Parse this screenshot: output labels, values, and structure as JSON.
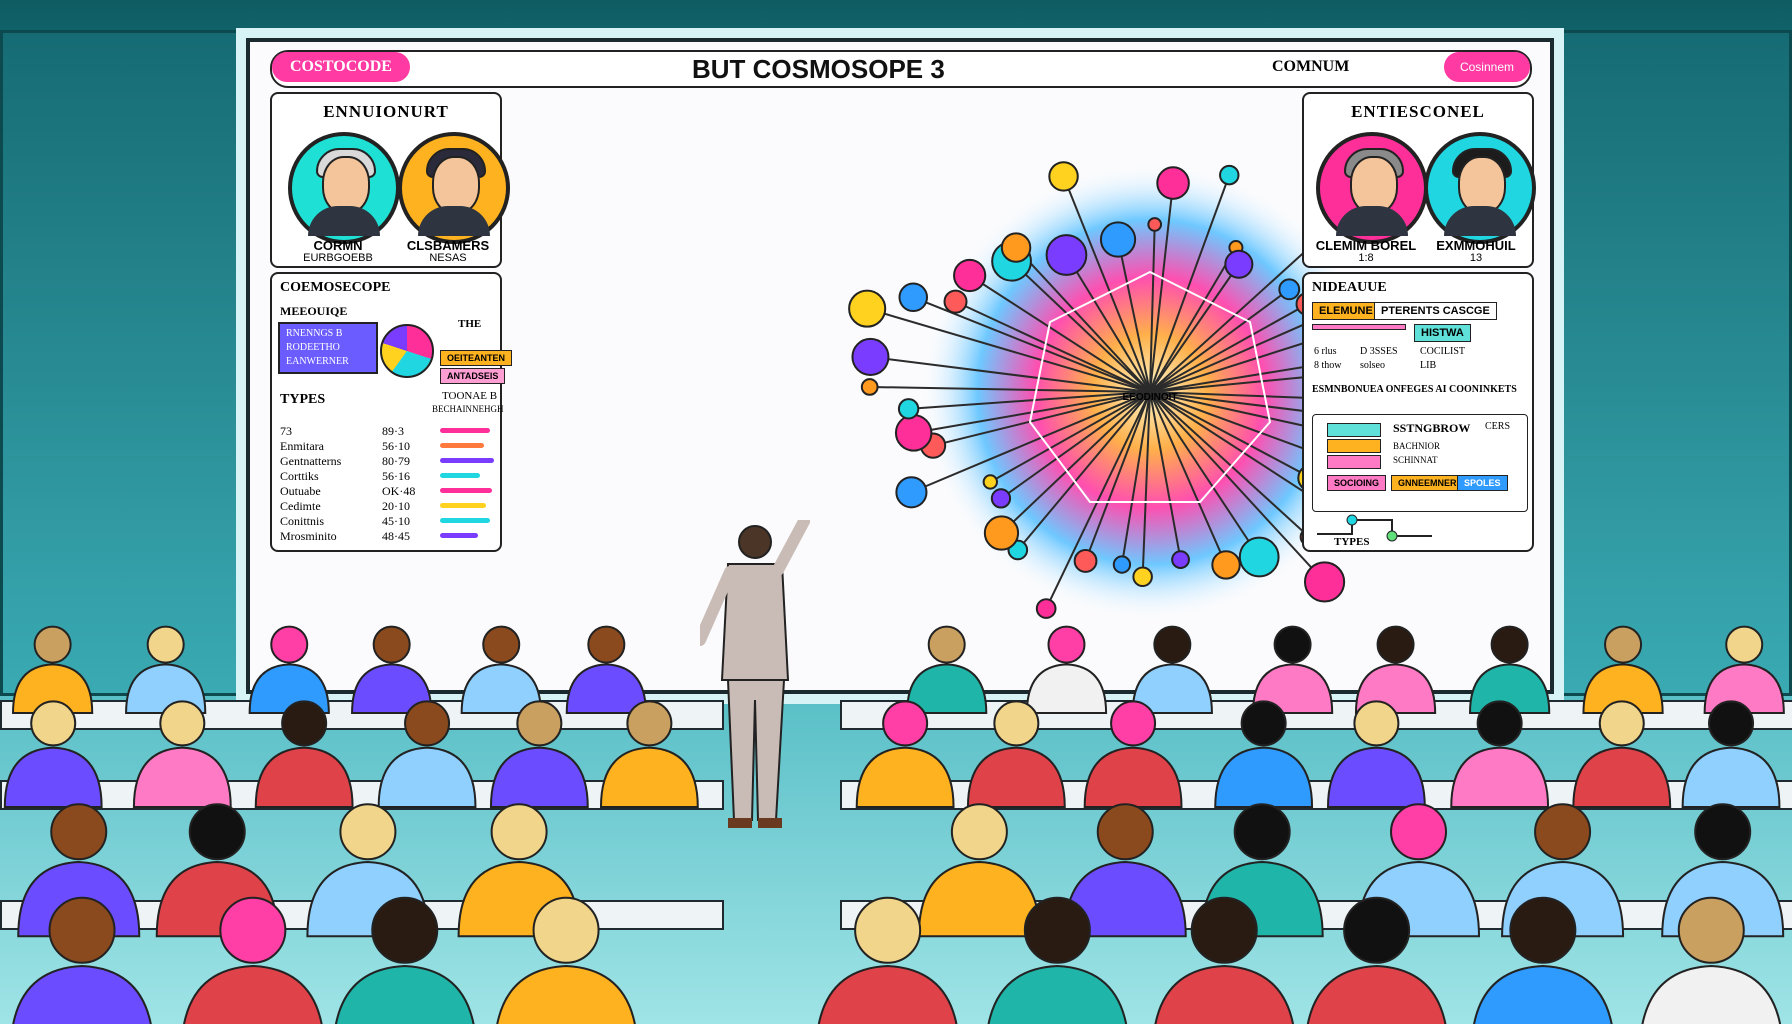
{
  "board": {
    "brand": "COSTOCODE",
    "title": "BUT COSMOSOPE  3",
    "right_label": "COMNUM",
    "right_pill": "Cosinnem"
  },
  "left_panel": {
    "title": "ENNUIONURT",
    "people": [
      {
        "name": "CORMN",
        "sub": "EURBGOEBB"
      },
      {
        "name": "CLSBAMERS",
        "sub": "NESAS"
      }
    ],
    "section_title": "COEMOSECOPE",
    "section_sub": "MEEOUIQE",
    "box_lines": [
      "RNENNGS B",
      "RODEETHO",
      "EANWERNER"
    ],
    "the_label": "THE",
    "tags": [
      "OEITEANTEN",
      "ANTADSEIS"
    ],
    "types_label": "TYPES",
    "toonae_label": "TOONAE B",
    "bechan_label": "BECHAINNEHGH",
    "rows": [
      {
        "label": "73",
        "value": "89·3"
      },
      {
        "label": "Enmitara",
        "value": "56·10"
      },
      {
        "label": "Gentnatterns",
        "value": "80·79"
      },
      {
        "label": "Corttiks",
        "value": "56·16"
      },
      {
        "label": "Outuabe",
        "value": "OK·48"
      },
      {
        "label": "Cedimte",
        "value": "20·10"
      },
      {
        "label": "Conittnis",
        "value": "45·10"
      },
      {
        "label": "Mrosminito",
        "value": "48·45"
      }
    ]
  },
  "right_panel": {
    "title": "ENTIESCONEL",
    "people": [
      {
        "name": "CLEMIM BOREL",
        "sub": "1:8"
      },
      {
        "name": "EXMMOHUIL",
        "sub": "13"
      }
    ],
    "section_title": "NIDEAUUE",
    "tags": [
      "ELEMUNE",
      "PTERENTS CASCGE"
    ],
    "pink_tag": "HISTWA",
    "mini": [
      "6 rlus",
      "8 thow",
      "D 3SSES",
      "solseo",
      "COCILIST",
      "LIB"
    ],
    "caption": "ESMNBONUEA ONFEGES AI COONINKETS",
    "flow_title": "SSTNGBROW",
    "flow_badge": "CERS",
    "flow_items": [
      "BACHNIOR",
      "SCHINNAT",
      "SOCIOING",
      "GNNEEMNER",
      "SPOLES"
    ],
    "types_label": "TYPES"
  },
  "network": {
    "center_label": "EEODINOIT"
  },
  "colors": {
    "magenta": "#ff2f9a",
    "cyan": "#20d6e0",
    "orange": "#ff9a1f",
    "purple": "#7a3cff",
    "yellow": "#ffd21f"
  }
}
